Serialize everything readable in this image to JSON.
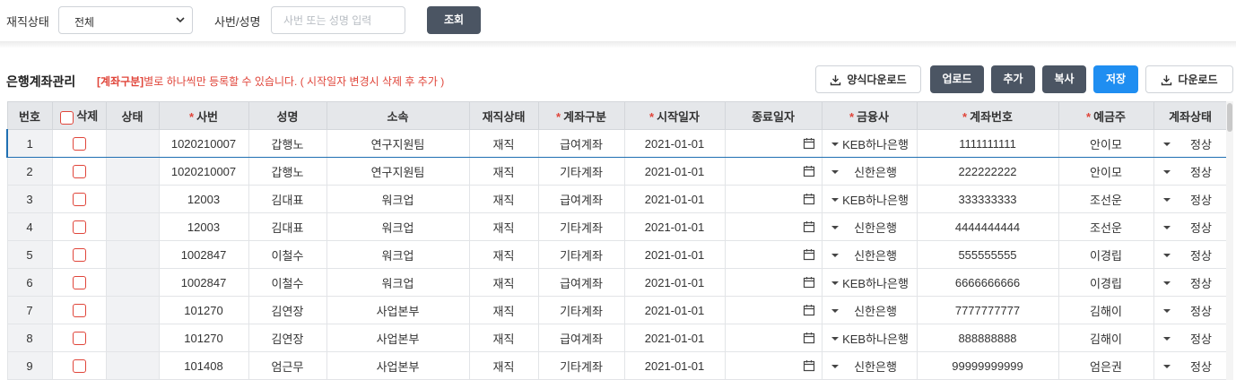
{
  "filter": {
    "status_label": "재직상태",
    "status_value": "전체",
    "emp_label": "사번/성명",
    "emp_placeholder": "사번 또는 성명 입력",
    "search_button": "조회"
  },
  "section": {
    "title": "은행계좌관리",
    "notice_bold": "[계좌구분]",
    "notice_rest": "별로 하나씩만 등록할 수 있습니다. ( 시작일자 변경시 삭제 후 추가 )"
  },
  "toolbar": {
    "template_download": "양식다운로드",
    "upload": "업로드",
    "add": "추가",
    "copy": "복사",
    "save": "저장",
    "download": "다운로드"
  },
  "grid": {
    "headers": {
      "no": "번호",
      "delete": "삭제",
      "state": "상태",
      "emp_no": "사번",
      "name": "성명",
      "dept": "소속",
      "emp_status": "재직상태",
      "acct_type": "계좌구분",
      "start": "시작일자",
      "end": "종료일자",
      "bank": "금융사",
      "acct_no": "계좌번호",
      "holder": "예금주",
      "acct_status": "계좌상태"
    },
    "rows": [
      {
        "no": "1",
        "emp_no": "1020210007",
        "name": "갑행노",
        "dept": "연구지원팀",
        "emp_status": "재직",
        "acct_type": "급여계좌",
        "start": "2021-01-01",
        "bank": "KEB하나은행",
        "acct_no": "1111111111",
        "holder": "안이모",
        "acct_status": "정상"
      },
      {
        "no": "2",
        "emp_no": "1020210007",
        "name": "갑행노",
        "dept": "연구지원팀",
        "emp_status": "재직",
        "acct_type": "기타계좌",
        "start": "2021-01-01",
        "bank": "신한은행",
        "acct_no": "222222222",
        "holder": "안이모",
        "acct_status": "정상"
      },
      {
        "no": "3",
        "emp_no": "12003",
        "name": "김대표",
        "dept": "워크업",
        "emp_status": "재직",
        "acct_type": "급여계좌",
        "start": "2021-01-01",
        "bank": "KEB하나은행",
        "acct_no": "333333333",
        "holder": "조선운",
        "acct_status": "정상"
      },
      {
        "no": "4",
        "emp_no": "12003",
        "name": "김대표",
        "dept": "워크업",
        "emp_status": "재직",
        "acct_type": "기타계좌",
        "start": "2021-01-01",
        "bank": "신한은행",
        "acct_no": "4444444444",
        "holder": "조선운",
        "acct_status": "정상"
      },
      {
        "no": "5",
        "emp_no": "1002847",
        "name": "이철수",
        "dept": "워크업",
        "emp_status": "재직",
        "acct_type": "기타계좌",
        "start": "2021-01-01",
        "bank": "신한은행",
        "acct_no": "555555555",
        "holder": "이경립",
        "acct_status": "정상"
      },
      {
        "no": "6",
        "emp_no": "1002847",
        "name": "이철수",
        "dept": "워크업",
        "emp_status": "재직",
        "acct_type": "급여계좌",
        "start": "2021-01-01",
        "bank": "KEB하나은행",
        "acct_no": "6666666666",
        "holder": "이경립",
        "acct_status": "정상"
      },
      {
        "no": "7",
        "emp_no": "101270",
        "name": "김연장",
        "dept": "사업본부",
        "emp_status": "재직",
        "acct_type": "기타계좌",
        "start": "2021-01-01",
        "bank": "신한은행",
        "acct_no": "7777777777",
        "holder": "김해이",
        "acct_status": "정상"
      },
      {
        "no": "8",
        "emp_no": "101270",
        "name": "김연장",
        "dept": "사업본부",
        "emp_status": "재직",
        "acct_type": "급여계좌",
        "start": "2021-01-01",
        "bank": "KEB하나은행",
        "acct_no": "888888888",
        "holder": "김해이",
        "acct_status": "정상"
      },
      {
        "no": "9",
        "emp_no": "101408",
        "name": "엄근무",
        "dept": "사업본부",
        "emp_status": "재직",
        "acct_type": "기타계좌",
        "start": "2021-01-01",
        "bank": "신한은행",
        "acct_no": "99999999999",
        "holder": "엄은권",
        "acct_status": "정상"
      }
    ]
  },
  "icons": {
    "select_chevron": "chevron-down-icon",
    "download": "download-icon",
    "calendar": "calendar-icon",
    "dropdown": "caret-down-icon"
  },
  "colors": {
    "dark_button": "#4b5563",
    "primary_button": "#1f8ef1",
    "required": "#e0453a",
    "selection": "#1f6fb2"
  }
}
